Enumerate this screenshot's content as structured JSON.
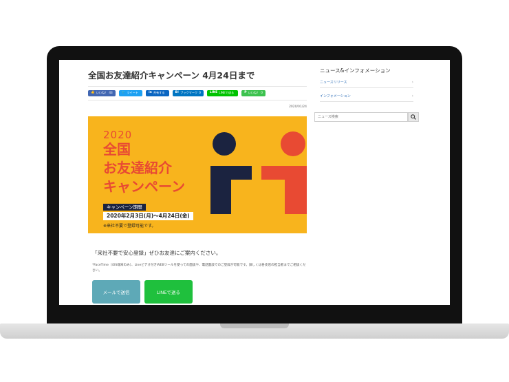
{
  "article": {
    "title": "全国お友達紹介キャンペーン 4月24日まで",
    "date": "2020/01/24",
    "share_buttons": [
      {
        "icon": "👍",
        "label": "いいね！",
        "count": "43",
        "color": "#4267b2"
      },
      {
        "icon": "🐦",
        "label": "ツイート",
        "count": "",
        "color": "#1da1f2"
      },
      {
        "icon": "in",
        "label": "共有する",
        "count": "",
        "color": "#0a66c2"
      },
      {
        "icon": "B!",
        "label": "ブックマーク",
        "count": "0",
        "color": "#0075c2"
      },
      {
        "icon": "LINE",
        "label": "LINEで送る",
        "count": "",
        "color": "#00c300"
      },
      {
        "icon": "P",
        "label": "いいね！",
        "count": "0",
        "color": "#3dc24f"
      }
    ],
    "banner": {
      "year": "2020",
      "line1": "全国",
      "line2": "お友達紹介",
      "line3": "キャンペーン",
      "period_label": "キャンペーン期間",
      "period_dates": "2020年2月3日(月)～4月24日(金)",
      "note": "※来社不要で登録可能です。",
      "colors": {
        "background": "#f8b41d",
        "text": "#e84a33",
        "navy": "#1b2340",
        "red": "#e84a33"
      }
    },
    "lead": "「来社不要で安心登録」ぜひお友達にご案内ください。",
    "note": "*FaceTime（iOS端末のみ）、Lineビデオ付きWEBツールを使っての面談や、電話面談でのご登録が可能です。詳しくは各支店の担当者までご相談ください。",
    "buttons": {
      "mail": "メールで送信",
      "line": "LINEで送る"
    }
  },
  "sidebar": {
    "title": "ニュース&インフォメーション",
    "items": [
      {
        "label": "ニュースリリース"
      },
      {
        "label": "インフォメーション"
      }
    ],
    "search_placeholder": "ニュース検索"
  }
}
